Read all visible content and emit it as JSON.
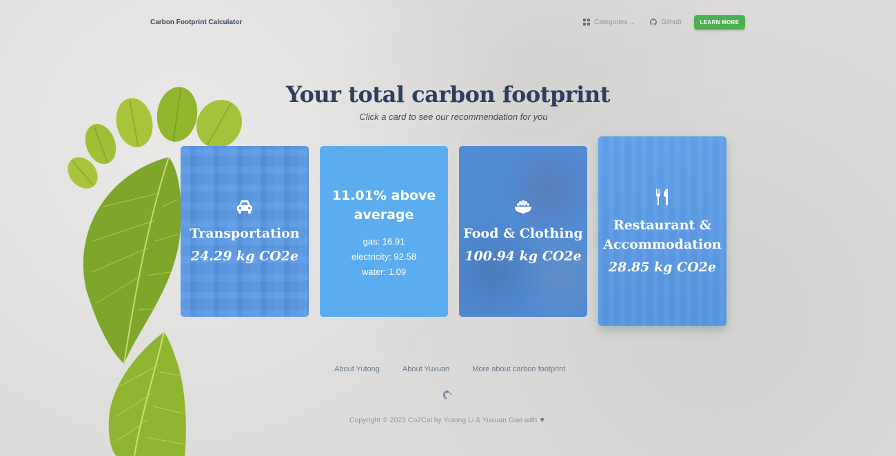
{
  "navbar": {
    "brand": "Carbon Footprint Calculator",
    "categories_label": "Categories",
    "github_label": "Github",
    "learn_more_label": "LEARN MORE",
    "accent_color": "#4caf50"
  },
  "header": {
    "title": "Your total carbon footprint",
    "subtitle": "Click a card to see our recommendation for you"
  },
  "cards": {
    "transportation": {
      "icon": "car-icon",
      "title": "Transportation",
      "value": "24.29 kg CO2e"
    },
    "average": {
      "title_line1": "11.01% above",
      "title_line2": "average",
      "lines": [
        "gas: 16.91",
        "electricity: 92.58",
        "water: 1.09"
      ]
    },
    "food": {
      "icon": "rice-bowl-icon",
      "title": "Food & Clothing",
      "value": "100.94 kg CO2e"
    },
    "restaurant": {
      "icon": "utensils-icon",
      "title_line1": "Restaurant &",
      "title_line2": "Accommodation",
      "value": "28.85 kg CO2e"
    }
  },
  "footer": {
    "links": [
      "About Yutong",
      "About Yuxuan",
      "More about carbon footprint"
    ],
    "copyright": "Copyright © 2023 Co2Cal by Yutong Li & Yuxuan Gao with"
  },
  "colors": {
    "card_blue": "#5badef",
    "title": "#2d3e5e"
  }
}
